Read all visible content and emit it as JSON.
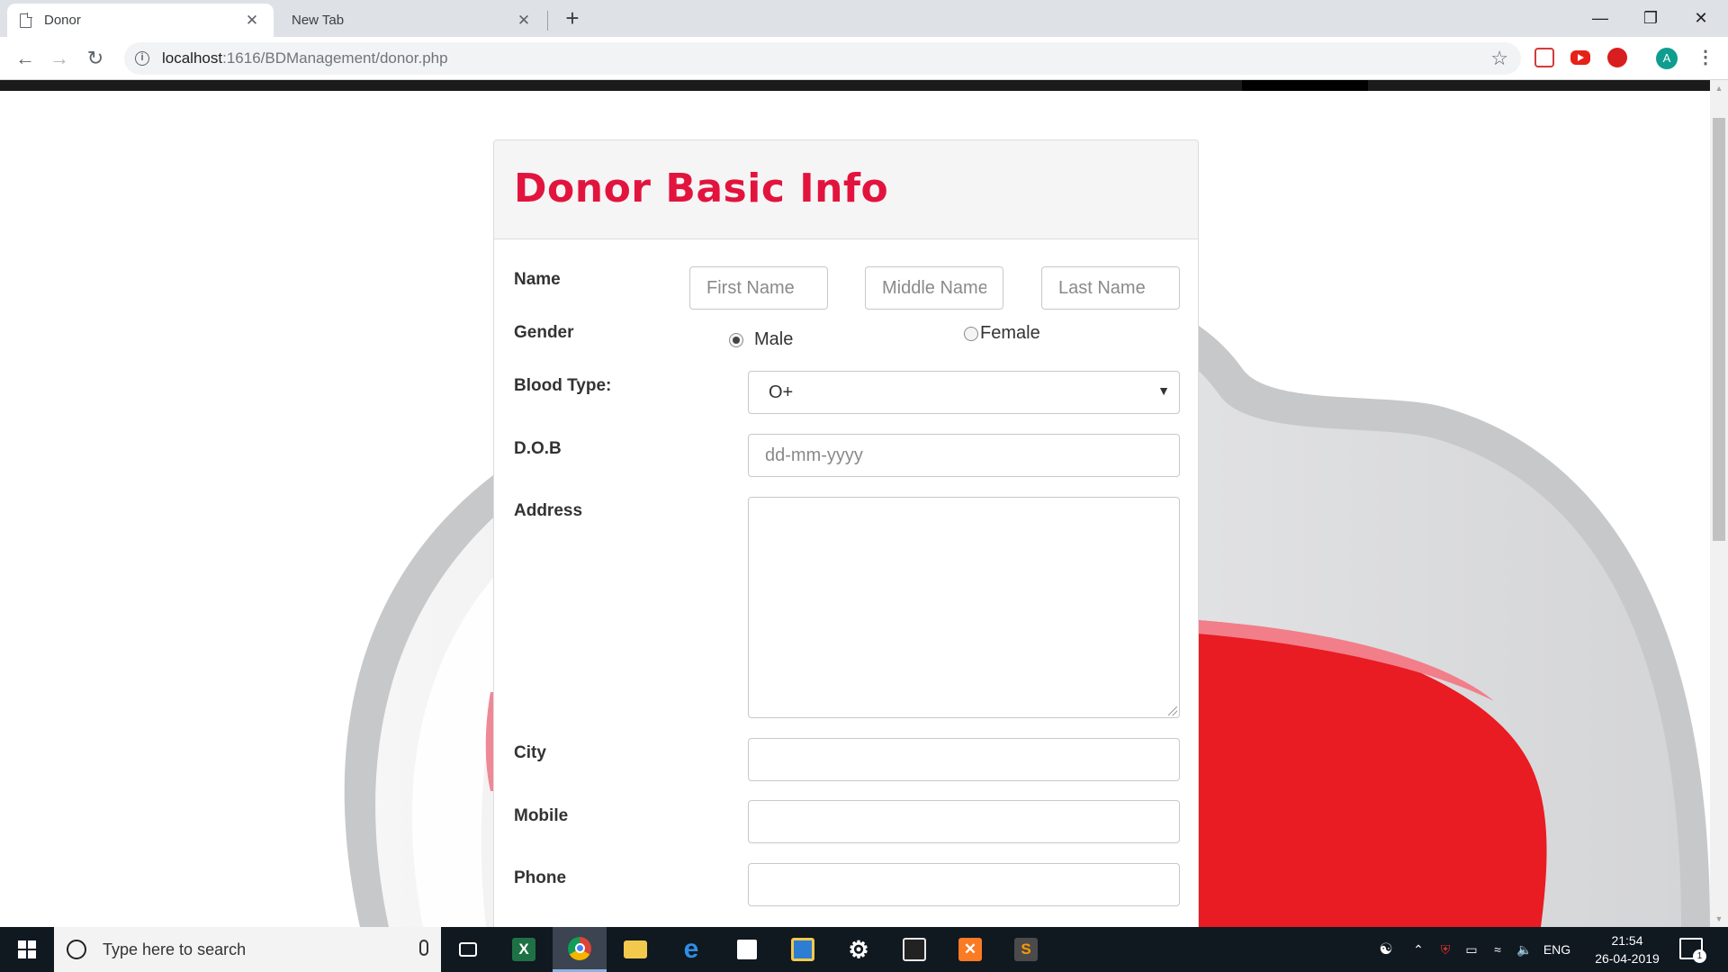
{
  "browser": {
    "tabs": [
      {
        "title": "Donor",
        "active": true
      },
      {
        "title": "New Tab",
        "active": false
      }
    ],
    "url_host": "localhost",
    "url_path": ":1616/BDManagement/donor.php",
    "profile_initial": "A"
  },
  "form": {
    "title": "Donor Basic Info",
    "name_label": "Name",
    "first_name_placeholder": "First Name",
    "middle_name_placeholder": "Middle Name",
    "last_name_placeholder": "Last Name",
    "gender_label": "Gender",
    "gender_options": [
      {
        "label": "Male",
        "checked": true
      },
      {
        "label": "Female",
        "checked": false
      }
    ],
    "blood_type_label": "Blood Type:",
    "blood_type_value": "O+",
    "dob_label": "D.O.B",
    "dob_placeholder": "dd-mm-yyyy",
    "address_label": "Address",
    "city_label": "City",
    "mobile_label": "Mobile",
    "phone_label": "Phone"
  },
  "taskbar": {
    "search_placeholder": "Type here to search",
    "language": "ENG",
    "time": "21:54",
    "date": "26-04-2019",
    "notification_count": "1"
  },
  "colors": {
    "title_accent": "#e2143e",
    "blood_red": "#e91b23",
    "taskbar": "#101820"
  }
}
